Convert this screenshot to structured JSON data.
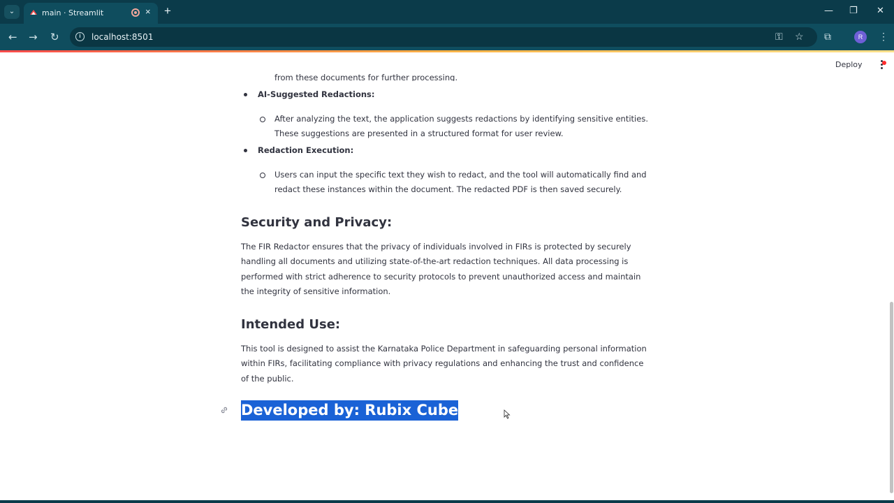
{
  "browser": {
    "tab_title": "main · Streamlit",
    "url": "localhost:8501",
    "new_tab_glyph": "+",
    "close_glyph": "×",
    "profile_initial": "R",
    "icons": [
      "tab-search-icon",
      "streamlit-favicon",
      "recording-icon",
      "back-icon",
      "forward-icon",
      "reload-icon",
      "site-info-icon",
      "password-key-icon",
      "bookmark-star-icon",
      "extensions-icon",
      "kebab-menu-icon"
    ]
  },
  "app_header": {
    "deploy_label": "Deploy"
  },
  "content": {
    "cut_line": "from these documents for further processing.",
    "bullet_1": "AI-Suggested Redactions:",
    "bullet_1_sub": "After analyzing the text, the application suggests redactions by identifying sensitive entities. These suggestions are presented in a structured format for user review.",
    "bullet_2": "Redaction Execution:",
    "bullet_2_sub": "Users can input the specific text they wish to redact, and the tool will automatically find and redact these instances within the document. The redacted PDF is then saved securely.",
    "security_heading": "Security and Privacy:",
    "security_text": "The FIR Redactor ensures that the privacy of individuals involved in FIRs is protected by securely handling all documents and utilizing state-of-the-art redaction techniques. All data processing is performed with strict adherence to security protocols to prevent unauthorized access and maintain the integrity of sensitive information.",
    "intended_heading": "Intended Use:",
    "intended_text": "This tool is designed to assist the Karnataka Police Department in safeguarding personal information within FIRs, facilitating compliance with privacy regulations and enhancing the trust and confidence of the public.",
    "developed_by": "Developed by: Rubix Cube"
  },
  "colors": {
    "chrome_bg": "#0b3b4a",
    "toolbar_bg": "#0f4d5e",
    "text": "#31333f",
    "selection": "#1a62d6",
    "accent": "#ff4b4b"
  }
}
